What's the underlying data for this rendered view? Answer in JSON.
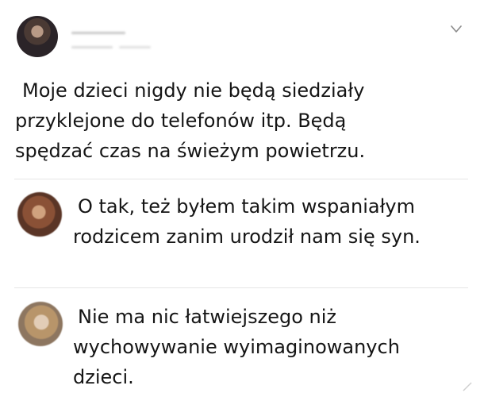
{
  "post": {
    "author_avatar": "avatar",
    "menu_icon": "chevron-down-icon",
    "text_lines": [
      "Moje dzieci nigdy nie będą siedziały",
      "przyklejone do telefonów itp. Będą",
      "spędzać czas na świeżym powietrzu."
    ]
  },
  "replies": [
    {
      "avatar": "avatar",
      "text_lines": [
        "O tak, też byłem takim wspaniałym",
        "rodzicem zanim urodził nam się syn."
      ]
    },
    {
      "avatar": "avatar",
      "text_lines": [
        "Nie ma nic łatwiejszego niż",
        "wychowywanie wyimaginowanych",
        "dzieci."
      ]
    }
  ],
  "colors": {
    "text": "#151515",
    "divider": "#e6e6e6",
    "icon": "#8a8a8a"
  }
}
